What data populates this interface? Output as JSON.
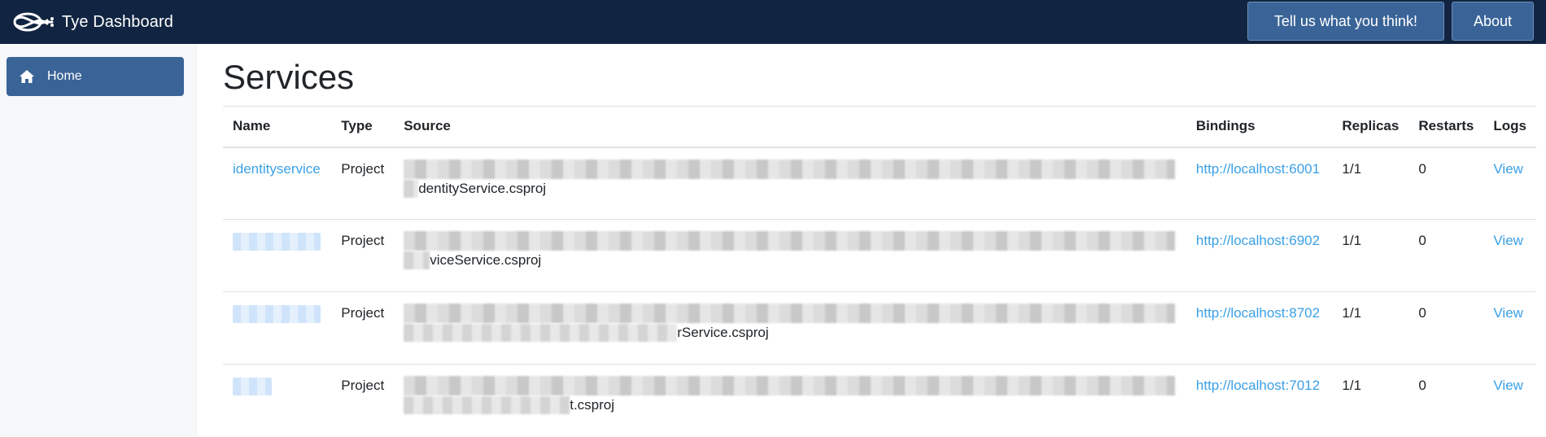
{
  "app": {
    "title": "Tye Dashboard",
    "logo_icon": "tye-knot-logo-icon"
  },
  "header": {
    "feedback_label": "Tell us what you think!",
    "about_label": "About"
  },
  "sidebar": {
    "items": [
      {
        "label": "Home",
        "icon": "home-icon"
      }
    ]
  },
  "main": {
    "title": "Services",
    "columns": [
      "Name",
      "Type",
      "Source",
      "Bindings",
      "Replicas",
      "Restarts",
      "Logs"
    ],
    "rows": [
      {
        "name": "identityservice",
        "name_redacted": false,
        "type": "Project",
        "source_tail": "dentityService.csproj",
        "binding": "http://localhost:6001",
        "replicas": "1/1",
        "restarts": "0",
        "logs": "View"
      },
      {
        "name": "",
        "name_redacted": true,
        "type": "Project",
        "source_tail": "viceService.csproj",
        "binding": "http://localhost:6902",
        "replicas": "1/1",
        "restarts": "0",
        "logs": "View"
      },
      {
        "name": "",
        "name_redacted": true,
        "type": "Project",
        "source_tail": "rService.csproj",
        "binding": "http://localhost:8702",
        "replicas": "1/1",
        "restarts": "0",
        "logs": "View"
      },
      {
        "name": "",
        "name_redacted": true,
        "type": "Project",
        "source_tail": "t.csproj",
        "binding": "http://localhost:7012",
        "replicas": "1/1",
        "restarts": "0",
        "logs": "View"
      }
    ]
  },
  "colors": {
    "topbar": "#112441",
    "accent": "#3a6497",
    "link": "#3aa0e6",
    "sidebar": "#f6f8fa"
  }
}
